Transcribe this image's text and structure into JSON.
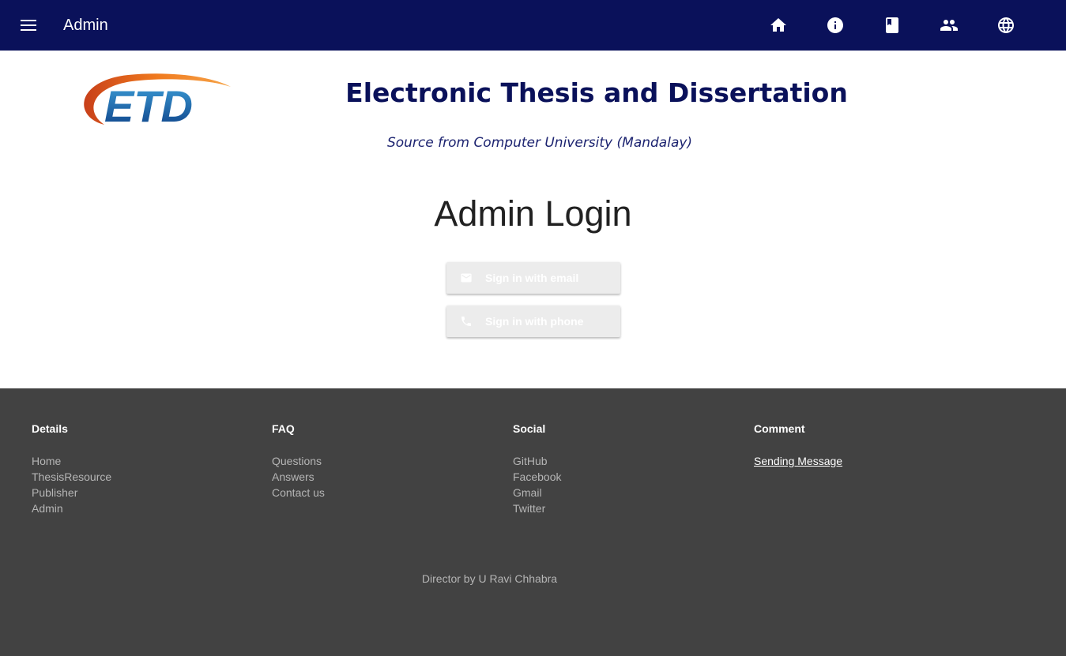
{
  "appbar": {
    "title": "Admin",
    "background": "#0a115a",
    "menu_icon": "menu-icon",
    "nav_icons": [
      "home-icon",
      "info-icon",
      "book-icon",
      "people-icon",
      "globe-icon"
    ]
  },
  "header": {
    "logo_text": "ETD",
    "site_title": "Electronic Thesis and Dissertation",
    "site_subtitle": "Source from Computer University (Mandalay)"
  },
  "main": {
    "heading": "Admin Login",
    "buttons": [
      {
        "label": "Sign in with email",
        "icon": "email-icon"
      },
      {
        "label": "Sign in with phone",
        "icon": "phone-icon"
      }
    ]
  },
  "footer": {
    "background": "#424242",
    "columns": [
      {
        "heading": "Details",
        "links": [
          "Home",
          "ThesisResource",
          "Publisher",
          "Admin"
        ]
      },
      {
        "heading": "FAQ",
        "links": [
          "Questions",
          "Answers",
          "Contact us"
        ]
      },
      {
        "heading": "Social",
        "links": [
          "GitHub",
          "Facebook",
          "Gmail",
          "Twitter"
        ]
      },
      {
        "heading": "Comment",
        "links": [
          "Sending Message"
        ]
      }
    ],
    "credit": "Director by U Ravi Chhabra"
  }
}
